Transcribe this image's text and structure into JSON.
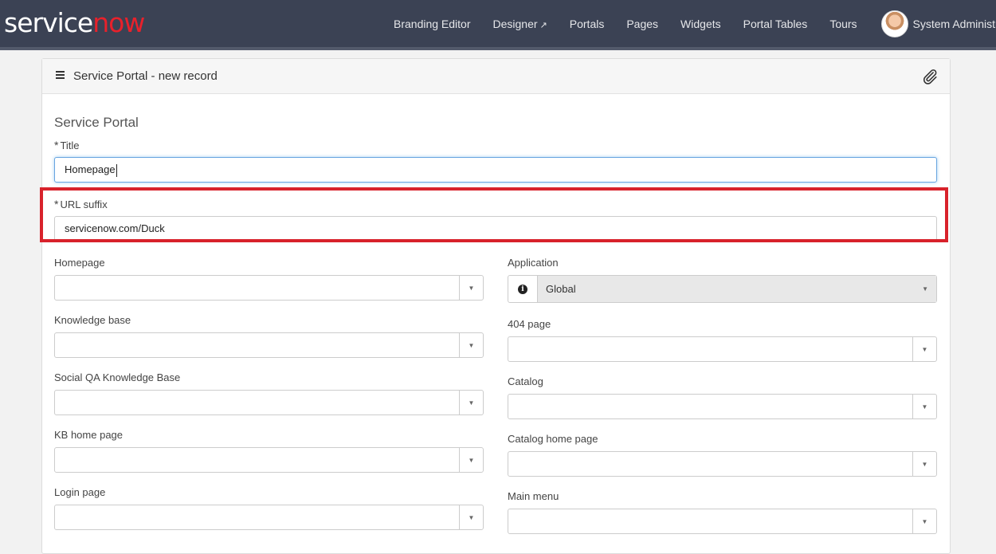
{
  "brand": {
    "service": "service",
    "now": "now"
  },
  "nav": {
    "items": [
      "Branding Editor",
      "Designer",
      "Portals",
      "Pages",
      "Widgets",
      "Portal Tables",
      "Tours"
    ],
    "designer_ext": "↗",
    "user_name": "System Administrator"
  },
  "card": {
    "title": "Service Portal - new record",
    "section": "Service Portal"
  },
  "form": {
    "required_mark": "*",
    "title_label": "Title",
    "title_value": "Homepage",
    "url_label": "URL suffix",
    "url_value": "servicenow.com/Duck",
    "left": [
      {
        "label": "Homepage"
      },
      {
        "label": "Knowledge base"
      },
      {
        "label": "Social QA Knowledge Base"
      },
      {
        "label": "KB home page"
      },
      {
        "label": "Login page"
      }
    ],
    "right": [
      {
        "label": "404 page"
      },
      {
        "label": "Catalog"
      },
      {
        "label": "Catalog home page"
      },
      {
        "label": "Main menu"
      }
    ],
    "application_label": "Application",
    "application_value": "Global",
    "info_glyph": "i",
    "arrow_glyph": "▼"
  },
  "colors": {
    "topbar": "#3b4254",
    "brand_red": "#e8212b",
    "highlight": "#d8222b"
  }
}
